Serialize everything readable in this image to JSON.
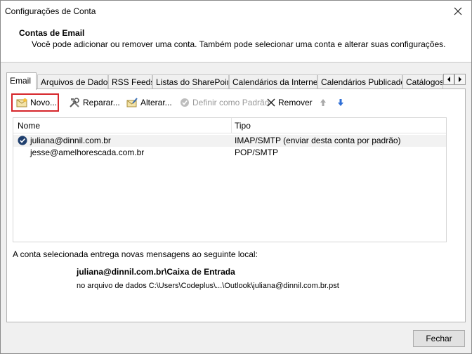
{
  "window": {
    "title": "Configurações de Conta"
  },
  "header": {
    "title": "Contas de Email",
    "description": "Você pode adicionar ou remover uma conta. Também pode selecionar uma conta e alterar suas configurações."
  },
  "tabs": [
    {
      "label": "Email",
      "active": true
    },
    {
      "label": "Arquivos de Dados"
    },
    {
      "label": "RSS Feeds"
    },
    {
      "label": "Listas do SharePoint"
    },
    {
      "label": "Calendários da Internet"
    },
    {
      "label": "Calendários Publicados"
    },
    {
      "label": "Catálogos de"
    }
  ],
  "toolbar": {
    "new_label": "Novo...",
    "repair_label": "Reparar...",
    "change_label": "Alterar...",
    "default_label": "Definir como Padrão",
    "remove_label": "Remover"
  },
  "accounts_table": {
    "col_name": "Nome",
    "col_type": "Tipo",
    "rows": [
      {
        "name": "juliana@dinnil.com.br",
        "type": "IMAP/SMTP (enviar desta conta por padrão)"
      },
      {
        "name": "jesse@amelhorescada.com.br",
        "type": "POP/SMTP"
      }
    ]
  },
  "delivery": {
    "label": "A conta selecionada entrega novas mensagens ao seguinte local:",
    "location": "juliana@dinnil.com.br\\Caixa de Entrada",
    "path": "no arquivo de dados C:\\Users\\Codeplus\\...\\Outlook\\juliana@dinnil.com.br.pst"
  },
  "footer": {
    "close_label": "Fechar"
  },
  "colors": {
    "highlight": "#d6262b",
    "arrow_blue": "#2f6fd6"
  }
}
